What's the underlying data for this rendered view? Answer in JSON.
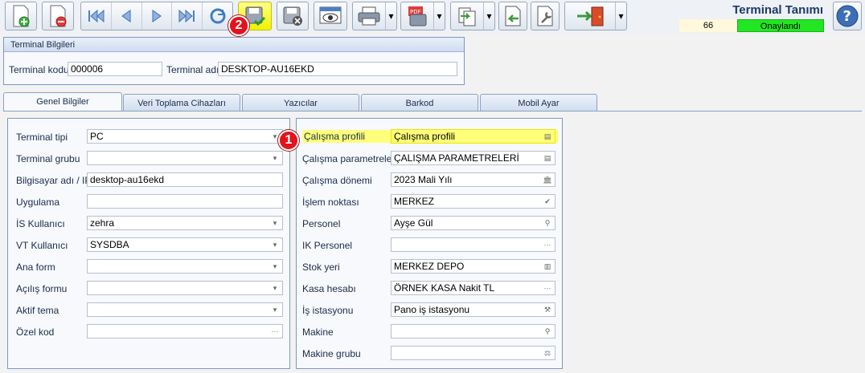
{
  "header": {
    "title": "Terminal Tanımı",
    "count": "66",
    "status": "Onaylandı"
  },
  "badges": {
    "one": "1",
    "two": "2"
  },
  "terminal_info": {
    "title": "Terminal Bilgileri",
    "code_label": "Terminal kodu",
    "code_value": "000006",
    "name_label": "Terminal adı",
    "name_value": "DESKTOP-AU16EKD"
  },
  "tabs": [
    "Genel Bilgiler",
    "Veri Toplama Cihazları",
    "Yazıcılar",
    "Barkod",
    "Mobil Ayar"
  ],
  "left_form": [
    {
      "label": "Terminal tipi",
      "value": "PC",
      "btn": "▾"
    },
    {
      "label": "Terminal grubu",
      "value": "",
      "btn": "▾"
    },
    {
      "label": "Bilgisayar adı / IP",
      "value": "desktop-au16ekd",
      "btn": ""
    },
    {
      "label": "Uygulama",
      "value": "",
      "btn": ""
    },
    {
      "label": "İS Kullanıcı",
      "value": "zehra",
      "btn": "▾"
    },
    {
      "label": "VT Kullanıcı",
      "value": "SYSDBA",
      "btn": "▾"
    },
    {
      "label": "Ana form",
      "value": "",
      "btn": "▾"
    },
    {
      "label": "Açılış formu",
      "value": "",
      "btn": "▾"
    },
    {
      "label": "Aktif tema",
      "value": "",
      "btn": "▾"
    },
    {
      "label": "Özel kod",
      "value": "",
      "btn": "···"
    }
  ],
  "right_form": [
    {
      "label": "Çalışma profili",
      "value": "Çalışma profili",
      "btn": "▤"
    },
    {
      "label": "Çalışma parametreleri",
      "value": "ÇALIŞMA PARAMETRELERİ",
      "btn": "▤"
    },
    {
      "label": "Çalışma dönemi",
      "value": "2023 Mali Yılı",
      "btn": "🏛"
    },
    {
      "label": "İşlem noktası",
      "value": "MERKEZ",
      "btn": "✔"
    },
    {
      "label": "Personel",
      "value": "Ayşe Gül",
      "btn": "⚲"
    },
    {
      "label": "IK Personel",
      "value": "",
      "btn": "···"
    },
    {
      "label": "Stok yeri",
      "value": "MERKEZ DEPO",
      "btn": "▥"
    },
    {
      "label": "Kasa hesabı",
      "value": "ÖRNEK KASA Nakit TL",
      "btn": "···"
    },
    {
      "label": "İş istasyonu",
      "value": "Pano iş istasyonu",
      "btn": "⚒"
    },
    {
      "label": "Makine",
      "value": "",
      "btn": "⚲"
    },
    {
      "label": "Makine grubu",
      "value": "",
      "btn": "⚖"
    }
  ]
}
